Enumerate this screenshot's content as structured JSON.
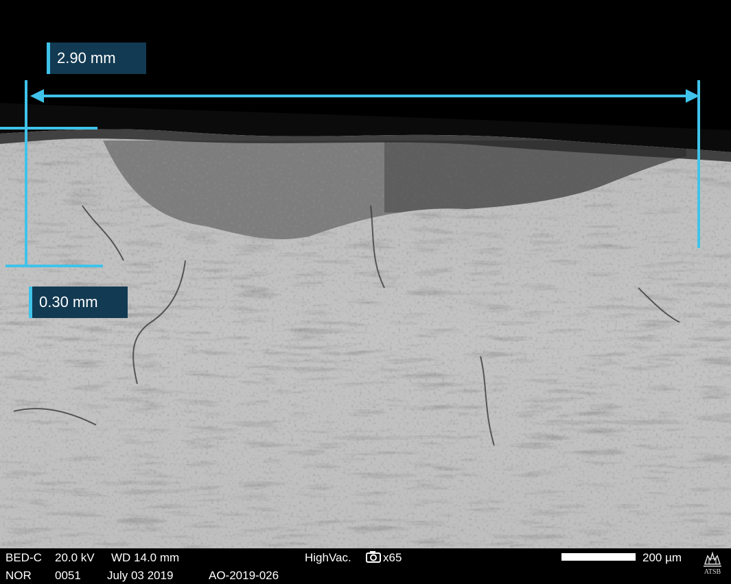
{
  "annotations": {
    "horizontal_label": "2.90 mm",
    "vertical_label": "0.30 mm",
    "accent_color": "#3fc3ea",
    "box_color": "#123a52"
  },
  "infobar": {
    "detector": "BED-C",
    "voltage": "20.0 kV",
    "working_distance": "WD 14.0 mm",
    "vacuum": "HighVac.",
    "magnification": "x65",
    "scale_label": "200 µm",
    "mode": "NOR",
    "image_number": "0051",
    "date": "July 03 2019",
    "reference": "AO-2019-026",
    "logo_text": "ATSB"
  },
  "icons": {
    "camera": "camera-icon",
    "logo": "atsb-crest-logo"
  }
}
